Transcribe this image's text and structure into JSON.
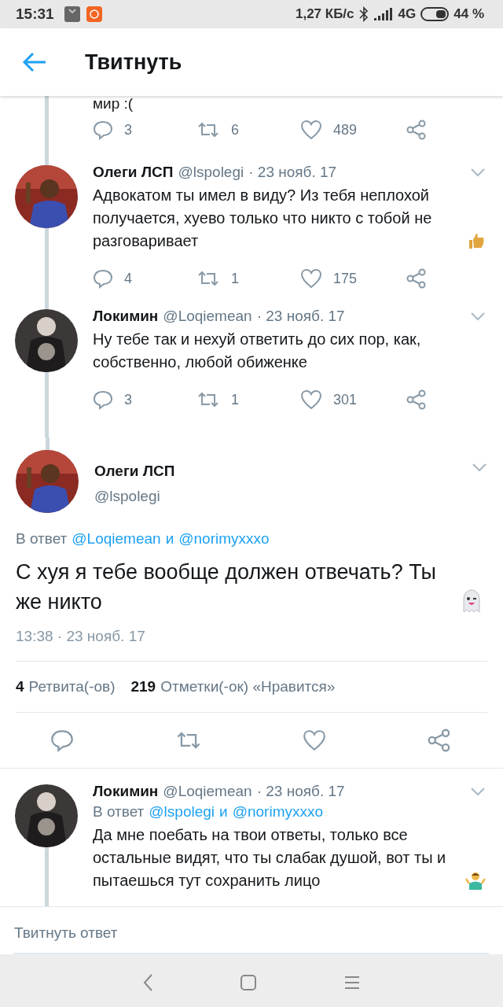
{
  "status_bar": {
    "time": "15:31",
    "speed": "1,27 КБ/с",
    "network": "4G",
    "battery": "44 %"
  },
  "header": {
    "title": "Твитнуть"
  },
  "previous_tweet": {
    "text_tail": "мир :(",
    "counts": {
      "replies": "3",
      "retweets": "6",
      "likes": "489"
    }
  },
  "replies": [
    {
      "name": "Олеги ЛСП",
      "handle": "@lspolegi",
      "date": "· 23 нояб. 17",
      "text": "Адвокатом ты имел в виду? Из тебя неплохой получается, хуево только что никто с тобой не разговаривает",
      "emoji": {
        "kind": "thumbsup"
      },
      "thread_above": true,
      "thread_below": true,
      "counts": {
        "replies": "4",
        "retweets": "1",
        "likes": "175"
      }
    },
    {
      "name": "Локимин",
      "handle": "@Loqiemean",
      "date": "· 23 нояб. 17",
      "text": "Ну тебе так и нехуй ответить до сих пор, как, собственно, любой обиженке",
      "thread_above": true,
      "thread_below": true,
      "counts": {
        "replies": "3",
        "retweets": "1",
        "likes": "301"
      }
    }
  ],
  "main_tweet": {
    "name": "Олеги ЛСП",
    "handle": "@lspolegi",
    "reply_prefix": "В ответ",
    "mentions": [
      "@Loqiemean",
      "@norimyxxxo"
    ],
    "mention_joiner": "и",
    "text": "С хуя я тебе вообще должен отвечать? Ты же никто",
    "emoji": {
      "kind": "ghost"
    },
    "timestamp": "13:38 · 23 нояб. 17",
    "stats": [
      {
        "count": "4",
        "label": "Ретвита(-ов)"
      },
      {
        "count": "219",
        "label": "Отметки(-ок) «Нравится»"
      }
    ]
  },
  "last_reply": {
    "name": "Локимин",
    "handle": "@Loqiemean",
    "date": "· 23 нояб. 17",
    "reply_prefix": "В ответ",
    "mentions": [
      "@lspolegi",
      "@norimyxxxo"
    ],
    "mention_joiner": "и",
    "text": "Да мне поебать на твои ответы, только все остальные видят, что ты слабак душой, вот ты и пытаешься тут сохранить лицо",
    "emoji": {
      "kind": "shrug"
    },
    "thread_above": false,
    "thread_below": true
  },
  "compose": {
    "placeholder": "Твитнуть ответ"
  }
}
